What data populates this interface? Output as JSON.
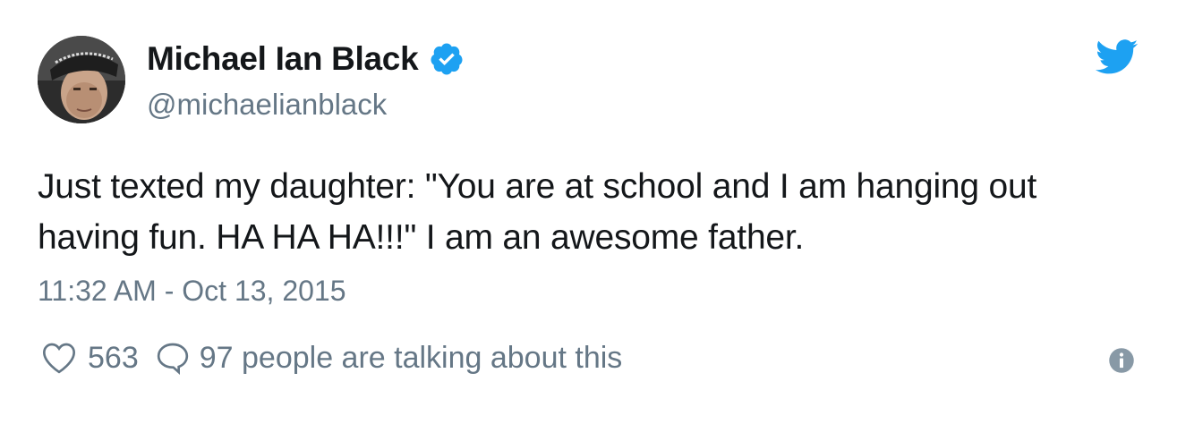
{
  "author": {
    "display_name": "Michael Ian Black",
    "handle": "@michaelianblack",
    "verified": true,
    "avatar_icon": "user-avatar-photo"
  },
  "tweet": {
    "text": "Just texted my daughter: \"You are at school and I am hanging out having fun. HA HA HA!!!\" I am an awesome father.",
    "timestamp": "11:32 AM - Oct 13, 2015"
  },
  "actions": {
    "like_count": "563",
    "reply_text": "97 people are talking about this"
  },
  "icons": {
    "brand": "twitter-bird-icon",
    "verified": "verified-badge-icon",
    "like": "heart-icon",
    "reply": "speech-bubble-icon",
    "info": "info-icon"
  },
  "colors": {
    "brand_blue": "#1da1f2",
    "text": "#14171a",
    "secondary_text": "#657786"
  }
}
